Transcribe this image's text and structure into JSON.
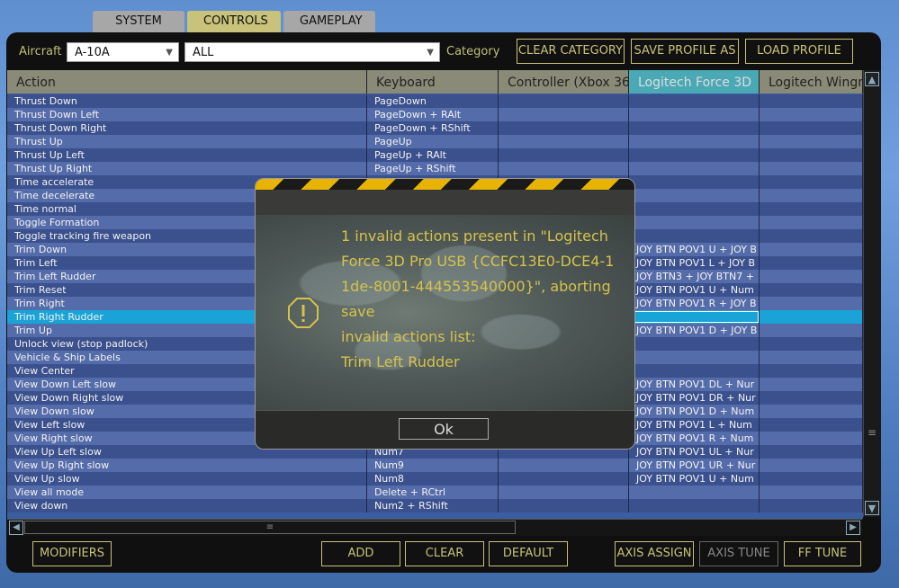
{
  "tabs": [
    "SYSTEM",
    "CONTROLS",
    "GAMEPLAY"
  ],
  "toolbar": {
    "aircraft_label": "Aircraft",
    "aircraft_value": "A-10A",
    "filter_value": "ALL",
    "category_label": "Category",
    "clear_category": "CLEAR CATEGORY",
    "save_profile_as": "SAVE PROFILE AS",
    "load_profile": "LOAD PROFILE"
  },
  "columns": [
    "Action",
    "Keyboard",
    "Controller (Xbox 36",
    "Logitech Force 3D",
    "Logitech Wingm"
  ],
  "rows": [
    [
      "Thrust Down",
      "PageDown",
      "",
      "",
      ""
    ],
    [
      "Thrust Down Left",
      "PageDown + RAlt",
      "",
      "",
      ""
    ],
    [
      "Thrust Down Right",
      "PageDown + RShift",
      "",
      "",
      ""
    ],
    [
      "Thrust Up",
      "PageUp",
      "",
      "",
      ""
    ],
    [
      "Thrust Up Left",
      "PageUp + RAlt",
      "",
      "",
      ""
    ],
    [
      "Thrust Up Right",
      "PageUp + RShift",
      "",
      "",
      ""
    ],
    [
      "Time accelerate",
      "",
      "",
      "",
      ""
    ],
    [
      "Time decelerate",
      "",
      "",
      "",
      ""
    ],
    [
      "Time normal",
      "",
      "",
      "",
      ""
    ],
    [
      "Toggle Formation",
      "",
      "",
      "",
      ""
    ],
    [
      "Toggle tracking fire weapon",
      "",
      "",
      "",
      ""
    ],
    [
      "Trim Down",
      "",
      "",
      "JOY BTN POV1 U + JOY B",
      ""
    ],
    [
      "Trim Left",
      "",
      "",
      "JOY BTN POV1 L + JOY B",
      ""
    ],
    [
      "Trim Left Rudder",
      "",
      "",
      "JOY BTN3 + JOY BTN7 +",
      ""
    ],
    [
      "Trim Reset",
      "",
      "",
      "JOY BTN POV1 U + Num",
      ""
    ],
    [
      "Trim Right",
      "",
      "",
      "JOY BTN POV1 R + JOY B",
      ""
    ],
    [
      "Trim Right Rudder",
      "",
      "",
      "",
      ""
    ],
    [
      "Trim Up",
      "",
      "",
      "JOY BTN POV1 D + JOY B",
      ""
    ],
    [
      "Unlock view (stop padlock)",
      "",
      "",
      "",
      ""
    ],
    [
      "Vehicle & Ship Labels",
      "",
      "",
      "",
      ""
    ],
    [
      "View Center",
      "",
      "",
      "",
      ""
    ],
    [
      "View Down Left slow",
      "",
      "",
      "JOY BTN POV1 DL + Nur",
      ""
    ],
    [
      "View Down Right slow",
      "",
      "",
      "JOY BTN POV1 DR + Nur",
      ""
    ],
    [
      "View Down slow",
      "",
      "",
      "JOY BTN POV1 D + Num",
      ""
    ],
    [
      "View Left slow",
      "",
      "",
      "JOY BTN POV1 L + Num",
      ""
    ],
    [
      "View Right slow",
      "",
      "",
      "JOY BTN POV1 R + Num",
      ""
    ],
    [
      "View Up Left slow",
      "Num7",
      "",
      "JOY BTN POV1 UL + Nur",
      ""
    ],
    [
      "View Up Right slow",
      "Num9",
      "",
      "JOY BTN POV1 UR + Nur",
      ""
    ],
    [
      "View Up slow",
      "Num8",
      "",
      "JOY BTN POV1 U + Num",
      ""
    ],
    [
      "View all mode",
      "Delete + RCtrl",
      "",
      "",
      ""
    ],
    [
      "View down",
      "Num2 + RShift",
      "",
      "",
      ""
    ]
  ],
  "selected_row": 16,
  "bottom": {
    "modifiers": "MODIFIERS",
    "add": "ADD",
    "clear": "CLEAR",
    "default": "DEFAULT",
    "axis_assign": "AXIS ASSIGN",
    "axis_tune": "AXIS TUNE",
    "ff_tune": "FF TUNE"
  },
  "dialog": {
    "message": "1 invalid actions present in \"Logitech Force 3D Pro USB {CCFC13E0-DCE4-11de-8001-444553540000}\", aborting save",
    "list_label": "invalid actions list:",
    "invalid_action": "Trim Left Rudder",
    "ok": "Ok",
    "icon": "warning-icon"
  },
  "colors": {
    "accent": "#c8c27a",
    "selection": "#1aa3d6",
    "dialog_text": "#d6c24a"
  }
}
